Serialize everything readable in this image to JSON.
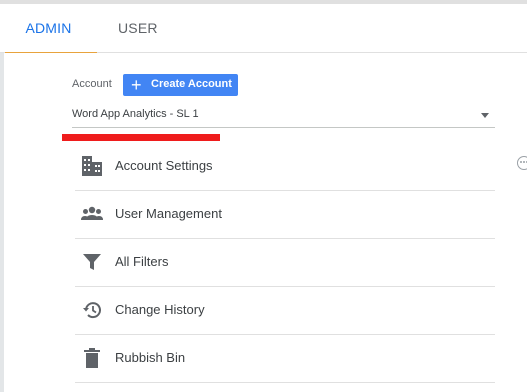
{
  "tabs": {
    "admin": "ADMIN",
    "user": "USER"
  },
  "account": {
    "label": "Account",
    "create_button": "Create Account",
    "selected": "Word App Analytics - SL 1"
  },
  "menu": [
    {
      "label": "Account Settings",
      "icon": "building-icon"
    },
    {
      "label": "User Management",
      "icon": "people-icon"
    },
    {
      "label": "All Filters",
      "icon": "filter-icon"
    },
    {
      "label": "Change History",
      "icon": "history-icon"
    },
    {
      "label": "Rubbish Bin",
      "icon": "trash-icon"
    }
  ],
  "colors": {
    "accent": "#1a73e8",
    "button": "#4285f4",
    "highlight": "#ef1c1c",
    "tab_underline": "#e8a33d"
  }
}
